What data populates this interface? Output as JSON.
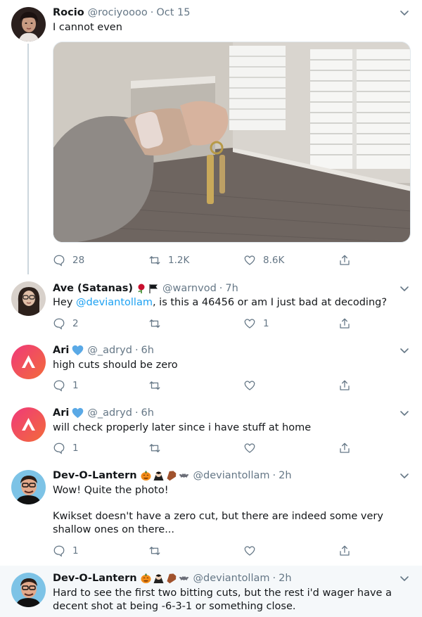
{
  "tweets": [
    {
      "name": "Rocio",
      "handle": "@rociyoooo",
      "time": "Oct 15",
      "text": "I cannot even",
      "replies": "28",
      "retweets": "1.2K",
      "likes": "8.6K"
    },
    {
      "name": "Ave (Satanas)",
      "emojis": [
        "rose",
        "black-flag"
      ],
      "handle": "@warnvod",
      "time": "7h",
      "text_before": "Hey ",
      "mention": "@deviantollam",
      "text_after": ", is this a 46456 or am I just bad at decoding?",
      "replies": "2",
      "retweets": "",
      "likes": "1"
    },
    {
      "name": "Ari",
      "emojis": [
        "blue-heart"
      ],
      "handle": "@_adryd",
      "time": "6h",
      "text": "high cuts should be zero",
      "replies": "1",
      "retweets": "",
      "likes": ""
    },
    {
      "name": "Ari",
      "emojis": [
        "blue-heart"
      ],
      "handle": "@_adryd",
      "time": "6h",
      "text": "will check properly later since i have stuff at home",
      "replies": "1",
      "retweets": "",
      "likes": ""
    },
    {
      "name": "Dev-O-Lantern",
      "emojis": [
        "jack-o-lantern",
        "vampire",
        "coffin",
        "bat"
      ],
      "handle": "@deviantollam",
      "time": "2h",
      "text": "Wow!  Quite the photo!",
      "text2": "Kwikset doesn't have a zero cut, but there are indeed some very shallow ones on there...",
      "replies": "1",
      "retweets": "",
      "likes": ""
    },
    {
      "name": "Dev-O-Lantern",
      "emojis": [
        "jack-o-lantern",
        "vampire",
        "coffin",
        "bat"
      ],
      "handle": "@deviantollam",
      "time": "2h",
      "text": "Hard to see the first two bitting cuts, but the rest i'd wager have a decent shot at being -6-3-1 or something close."
    }
  ],
  "colors": {
    "text": "#14171a",
    "secondary": "#657786",
    "link": "#1da1f2",
    "thread_line": "#ccd6dd",
    "verified_heart": "#5aa9e6"
  }
}
